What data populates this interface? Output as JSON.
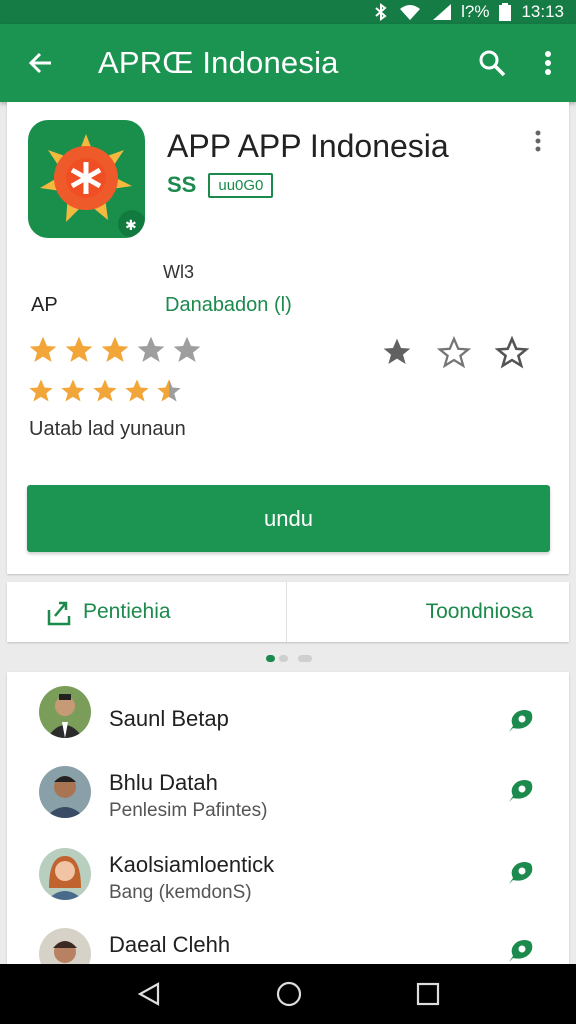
{
  "status": {
    "battery_text": "l?%",
    "time": "13:13",
    "icons": [
      "bluetooth-icon",
      "wifi-icon",
      "signal-icon",
      "battery-icon"
    ]
  },
  "appbar": {
    "title": "APRŒ Indonesia",
    "icons": [
      "back-arrow-icon",
      "search-icon",
      "more-vert-icon"
    ]
  },
  "app": {
    "name": "APP APP Indonesia",
    "developer_mark": "SS",
    "badge": "uu0G0",
    "meta_small": "Wl3",
    "meta_left": "AP",
    "downloads": "Danabadon (l)",
    "rating_1": 3,
    "rating_2": 4.5,
    "rating_caption": "Uatab lad yunaun",
    "install_label": "undu"
  },
  "actions": {
    "left_label": "Pentiehia",
    "right_label": "Toondniosa"
  },
  "carousel": {
    "active_index": 0,
    "count": 3
  },
  "people": [
    {
      "name": "Saunl Betap",
      "sub": ""
    },
    {
      "name": "Bhlu Datah",
      "sub": "Penlesim Pafintes)"
    },
    {
      "name": "Kaolsiamloentick",
      "sub": "Bang (kemdonS)"
    },
    {
      "name": "Daeal Clehh",
      "sub": ""
    }
  ],
  "colors": {
    "primary": "#1b9451",
    "status_bar": "#157c45",
    "star_gold": "#f2a63a",
    "star_grey": "#9e9e9e"
  }
}
